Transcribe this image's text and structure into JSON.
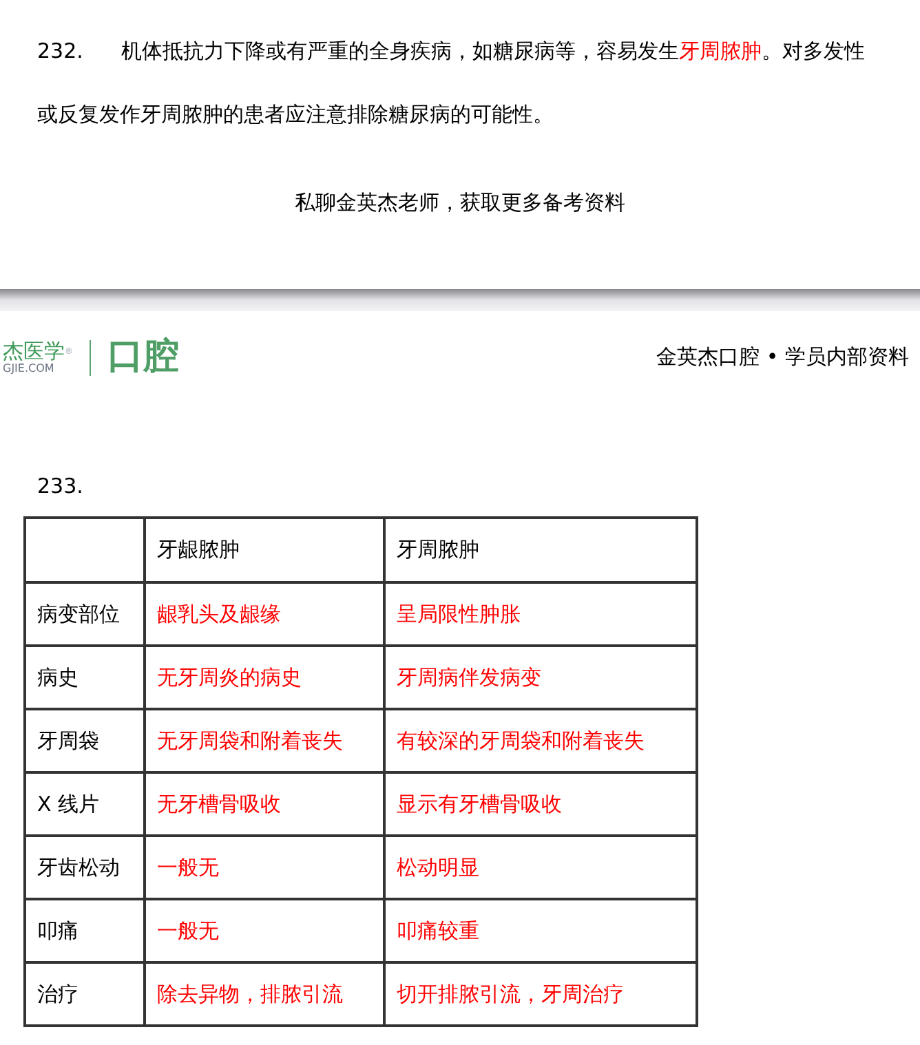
{
  "page_1": {
    "question_number": "232.",
    "paragraph": [
      {
        "text": "机体抵抗力下降或有严重的全身疾病，如糖尿病等，容易发生",
        "highlight": false
      },
      {
        "text": "牙周脓肿",
        "highlight": true
      },
      {
        "text": "。对多发性或反复发作牙周脓肿的患者应注意排除糖尿病的可能性。",
        "highlight": false
      }
    ],
    "footer": "私聊金英杰老师，获取更多备考资料"
  },
  "page_2": {
    "header": {
      "logo_text": "杰医学",
      "logo_mark": "®",
      "logo_url": "GJIE.COM",
      "section": "口腔",
      "title": "金英杰口腔 • 学员内部资料"
    },
    "question_number": "233.",
    "table": {
      "columns": [
        "",
        "牙龈脓肿",
        "牙周脓肿"
      ],
      "rows": [
        [
          "病变部位",
          "龈乳头及龈缘",
          "呈局限性肿胀"
        ],
        [
          "病史",
          "无牙周炎的病史",
          "牙周病伴发病变"
        ],
        [
          "牙周袋",
          "无牙周袋和附着丧失",
          "有较深的牙周袋和附着丧失"
        ],
        [
          "X 线片",
          "无牙槽骨吸收",
          "显示有牙槽骨吸收"
        ],
        [
          "牙齿松动",
          "一般无",
          "松动明显"
        ],
        [
          "叩痛",
          "一般无",
          "叩痛较重"
        ],
        [
          "治疗",
          "除去异物，排脓引流",
          "切开排脓引流，牙周治疗"
        ]
      ]
    }
  }
}
